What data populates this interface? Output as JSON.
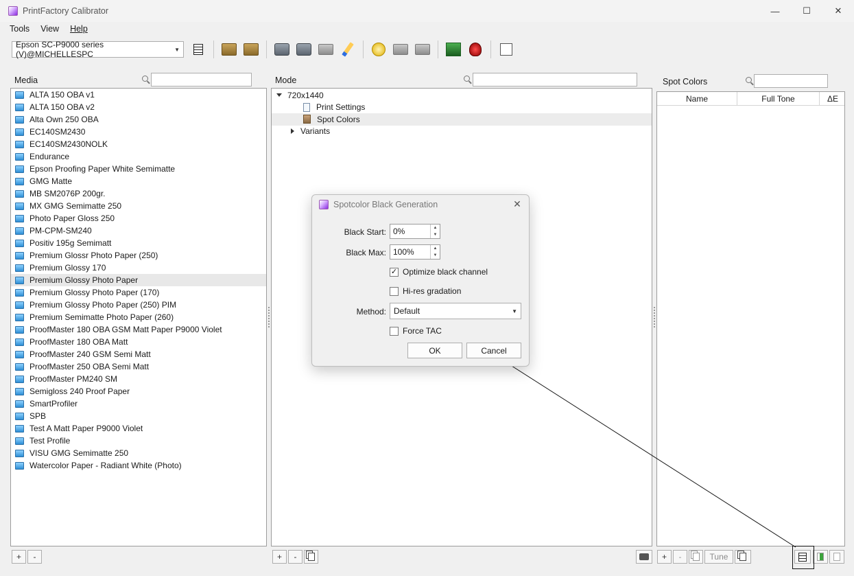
{
  "window": {
    "title": "PrintFactory Calibrator",
    "minimize": "—",
    "maximize": "☐",
    "close": "✕"
  },
  "menu": {
    "tools": "Tools",
    "view": "View",
    "help": "Help"
  },
  "toolbar": {
    "printer_selected": "Epson SC-P9000 series (V)@MICHELLESPC"
  },
  "media": {
    "label": "Media",
    "search_value": "",
    "items": [
      "ALTA 150 OBA v1",
      "ALTA 150 OBA v2",
      "Alta Own 250 OBA",
      "EC140SM2430",
      "EC140SM2430NOLK",
      "Endurance",
      "Epson Proofing Paper White Semimatte",
      "GMG Matte",
      "MB SM2076P 200gr.",
      "MX GMG Semimatte 250",
      "Photo Paper Gloss 250",
      "PM-CPM-SM240",
      "Positiv 195g Semimatt",
      "Premium Glossr Photo Paper (250)",
      "Premium Glossy 170",
      "Premium Glossy Photo Paper",
      "Premium Glossy Photo Paper (170)",
      "Premium Glossy Photo Paper (250) PIM",
      "Premium Semimatte Photo Paper (260)",
      "ProofMaster 180 OBA GSM Matt Paper P9000 Violet",
      "ProofMaster 180 OBA Matt",
      "ProofMaster 240 GSM Semi Matt",
      "ProofMaster 250 OBA Semi Matt",
      "ProofMaster PM240 SM",
      "Semigloss 240 Proof Paper",
      "SmartProfiler",
      "SPB",
      "Test A Matt Paper P9000 Violet",
      "Test Profile",
      "VISU GMG Semimatte 250",
      "Watercolor Paper - Radiant White (Photo)"
    ],
    "add": "+",
    "remove": "-"
  },
  "mode": {
    "label": "Mode",
    "search_value": "",
    "root": "720x1440",
    "print_settings": "Print Settings",
    "spot_colors": "Spot Colors",
    "variants": "Variants",
    "add": "+",
    "remove": "-"
  },
  "spot": {
    "label": "Spot Colors",
    "search_value": "",
    "col_name": "Name",
    "col_full_tone": "Full Tone",
    "col_delta_e": "ΔE",
    "add": "+",
    "remove": "-",
    "tune": "Tune"
  },
  "dialog": {
    "title": "Spotcolor Black Generation",
    "black_start_label": "Black Start:",
    "black_start_value": "0%",
    "black_max_label": "Black Max:",
    "black_max_value": "100%",
    "optimize_label": "Optimize black channel",
    "optimize_checked": true,
    "hires_label": "Hi-res gradation",
    "hires_checked": false,
    "method_label": "Method:",
    "method_value": "Default",
    "force_tac_label": "Force TAC",
    "force_tac_checked": false,
    "ok": "OK",
    "cancel": "Cancel",
    "check_glyph": "✓"
  },
  "icons": {
    "search": "search-icon",
    "folder": "folder-icon"
  }
}
